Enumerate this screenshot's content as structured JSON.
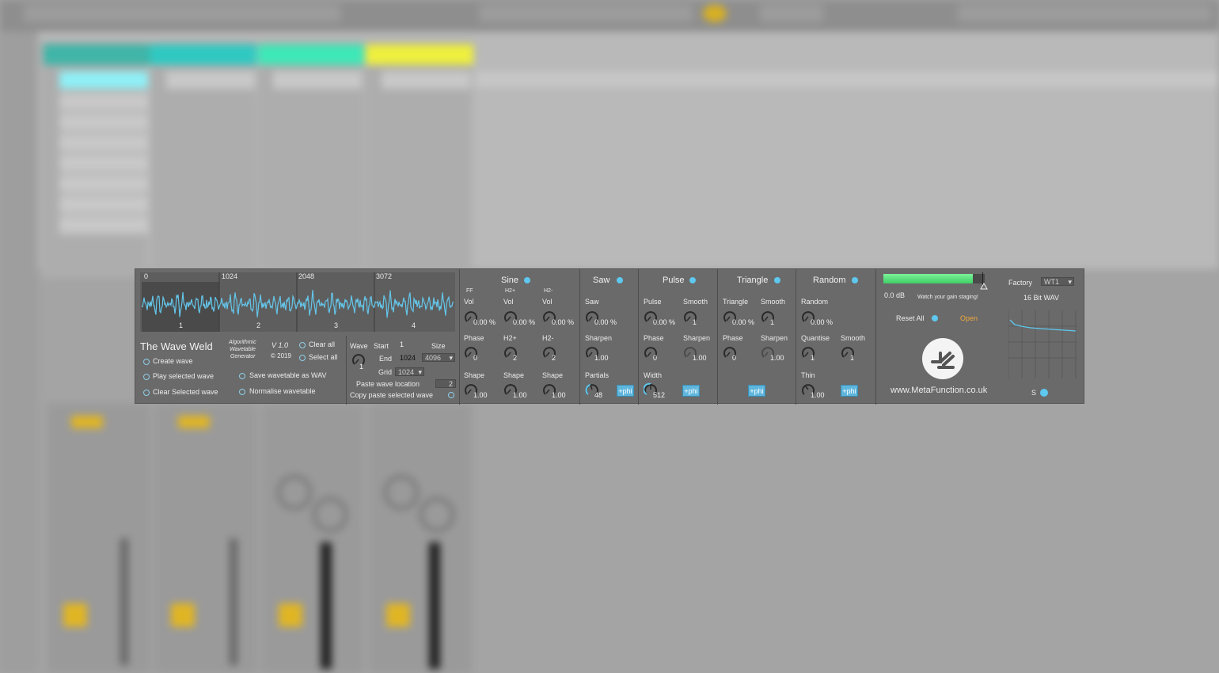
{
  "wave_display": {
    "markers": [
      "0",
      "1024",
      "2048",
      "3072"
    ],
    "segment_labels": [
      "1",
      "2",
      "3",
      "4"
    ]
  },
  "device": {
    "title": "The Wave Weld",
    "subtitle_lines": [
      "Algorithmic",
      "Wavetable",
      "Generator"
    ],
    "version": "V 1.0",
    "copyright": "© 2019",
    "actions": {
      "create": "Create wave",
      "play": "Play selected wave",
      "clear_selected": "Clear Selected wave",
      "clear_all": "Clear all",
      "select_all": "Select all",
      "save_wav": "Save wavetable as WAV",
      "normalise": "Normalise wavetable"
    }
  },
  "wave_select": {
    "wave_label": "Wave",
    "wave_value": "1",
    "start_label": "Start",
    "start_value": "1",
    "size_label": "Size",
    "size_value": "4096",
    "end_label": "End",
    "end_value": "1024",
    "grid_label": "Grid",
    "grid_value": "1024",
    "paste_label": "Paste wave location",
    "paste_value": "2",
    "copy_paste_label": "Copy paste selected wave"
  },
  "sine": {
    "title": "Sine",
    "ff": "FF",
    "h2p": "H2+",
    "h2m": "H2-",
    "vol_label": "Vol",
    "vol1": "0.00 %",
    "vol2": "0.00 %",
    "vol3": "0.00 %",
    "phase_label": "Phase",
    "h2p_label": "H2+",
    "h2m_label": "H2-",
    "phase_val": "0",
    "h2p_val": "2",
    "h2m_val": "2",
    "shape_label": "Shape",
    "shape1": "1.00",
    "shape2": "1.00",
    "shape3": "1.00"
  },
  "saw": {
    "title": "Saw",
    "saw_label": "Saw",
    "saw_val": "0.00 %",
    "sharpen_label": "Sharpen",
    "sharpen_val": "1.00",
    "partials_label": "Partials",
    "partials_val": "48",
    "phi": "+phi"
  },
  "pulse": {
    "title": "Pulse",
    "pulse_label": "Pulse",
    "pulse_val": "0.00 %",
    "smooth_label": "Smooth",
    "smooth_val": "1",
    "phase_label": "Phase",
    "phase_val": "0",
    "sharpen_label": "Sharpen",
    "sharpen_val": "1.00",
    "width_label": "Width",
    "width_val": "512",
    "phi": "+phi"
  },
  "triangle": {
    "title": "Triangle",
    "tri_label": "Triangle",
    "tri_val": "0.00 %",
    "smooth_label": "Smooth",
    "smooth_val": "1",
    "phase_label": "Phase",
    "phase_val": "0",
    "sharpen_label": "Sharpen",
    "sharpen_val": "1.00",
    "phi": "+phi"
  },
  "random": {
    "title": "Random",
    "random_label": "Random",
    "random_val": "0.00 %",
    "quantise_label": "Quantise",
    "quantise_val": "1",
    "smooth_label": "Smooth",
    "smooth_val": "1",
    "thin_label": "Thin",
    "thin_val": "1.00",
    "phi": "+phi"
  },
  "output": {
    "db": "0.0 dB",
    "gain_note": "Watch your gain staging!",
    "meter_level": 0.88,
    "reset_all": "Reset All",
    "open": "Open",
    "url": "www.MetaFunction.co.uk",
    "factory_label": "Factory",
    "factory_value": "WT1",
    "bit_depth": "16 Bit WAV",
    "s_label": "S"
  },
  "colors": {
    "accent": "#5ec8ef",
    "waveform": "#64c6ea",
    "open": "#f0a73a",
    "meter": "#59e07a"
  }
}
